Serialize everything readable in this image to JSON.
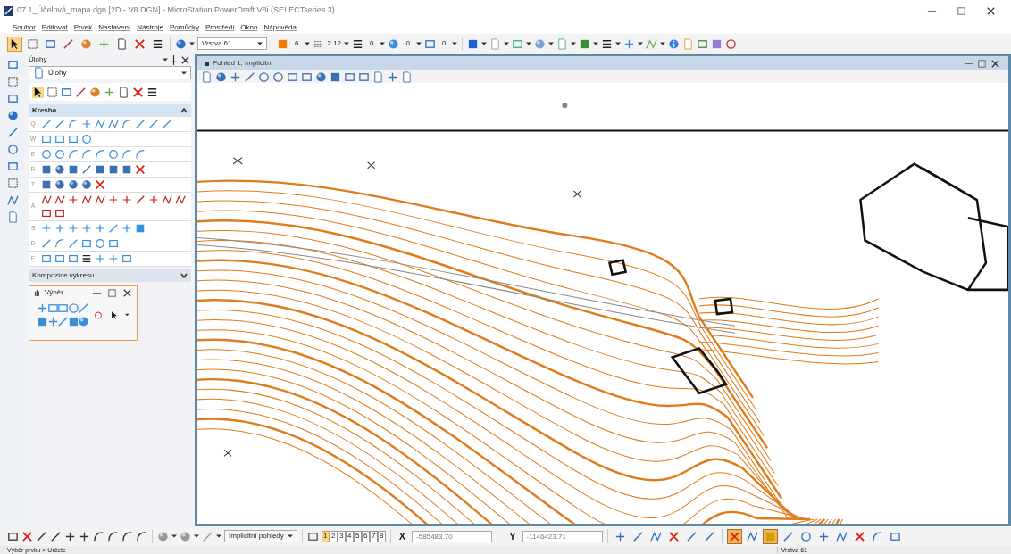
{
  "window": {
    "title": "07.1_Účelová_mapa.dgn [2D - V8 DGN] - MicroStation PowerDraft V8i (SELECTseries 3)"
  },
  "menu": [
    "Soubor",
    "Editovat",
    "Prvek",
    "Nastavení",
    "Nástroje",
    "Pomůcky",
    "Prostředí",
    "Okno",
    "Nápověda"
  ],
  "main_tools": [
    {
      "selected": true
    },
    {
      "selected": false
    },
    {
      "selected": false
    },
    {
      "selected": false
    },
    {
      "selected": false
    },
    {
      "selected": false
    },
    {
      "selected": false
    },
    {
      "selected": false
    },
    {
      "selected": false
    }
  ],
  "attributes": {
    "level": "Vrstva 61",
    "color_number": "6",
    "style": "2.12",
    "weight": "0",
    "transparency": "0",
    "priority": "0"
  },
  "tasks_panel": {
    "title": "Úlohy",
    "dropdown": "Úlohy",
    "sections": [
      {
        "title": "Kresba",
        "expanded": true,
        "rows": [
          {
            "key": "Q"
          },
          {
            "key": "W"
          },
          {
            "key": "E"
          },
          {
            "key": "R"
          },
          {
            "key": "T"
          },
          {
            "key": "A"
          },
          {
            "key": "S"
          },
          {
            "key": "D"
          },
          {
            "key": "F"
          }
        ]
      },
      {
        "title": "Kompozice výkresu",
        "expanded": false
      }
    ]
  },
  "selection_window": {
    "title": "Výběr ..."
  },
  "view": {
    "title": "Pohled 1, Implicitní"
  },
  "bottom_toolbar": {
    "views_dropdown": "Implicitní pohledy",
    "view_buttons": [
      {
        "label": "1",
        "selected": true
      },
      {
        "label": "2",
        "selected": false
      },
      {
        "label": "3",
        "selected": false
      },
      {
        "label": "4",
        "selected": false
      },
      {
        "label": "5",
        "selected": false
      },
      {
        "label": "6",
        "selected": false
      },
      {
        "label": "7",
        "selected": false
      },
      {
        "label": "8",
        "selected": false
      }
    ],
    "x_label": "X",
    "x_value": "-585483.70",
    "y_label": "Y",
    "y_value": "-1146423.71",
    "snaps": [
      {
        "selected": false
      },
      {
        "selected": false
      },
      {
        "selected": false
      },
      {
        "selected": false
      },
      {
        "selected": false
      },
      {
        "selected": false
      },
      {
        "selected": true
      },
      {
        "selected": false
      },
      {
        "selected": true
      },
      {
        "selected": false
      },
      {
        "selected": false
      },
      {
        "selected": false
      },
      {
        "selected": false
      },
      {
        "selected": false
      },
      {
        "selected": false
      },
      {
        "selected": false
      }
    ]
  },
  "status_bar": {
    "prompt": "Výběr prvku > Určete",
    "level": "Vrstva 61"
  }
}
